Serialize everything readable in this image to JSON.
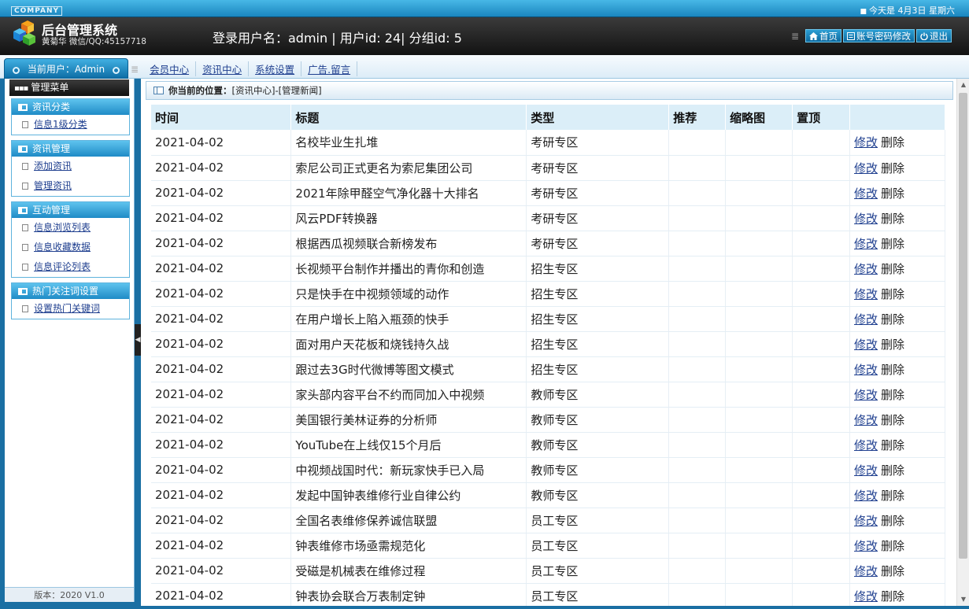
{
  "header": {
    "company": "COMPANY",
    "today": "今天是 4月3日  星期六",
    "title": "后台管理系统",
    "author": "黄菊华 微信/QQ:45157718",
    "login_info": "登录用户名：admin | 用户id: 24| 分组id: 5",
    "links": {
      "home": "首页",
      "password": "账号密码修改",
      "logout": "退出"
    },
    "colors": {
      "accent": "#1b86bf",
      "dark": "#1a1a1a"
    }
  },
  "subheader": {
    "current_user": "当前用户：Admin",
    "nav": [
      "会员中心",
      "资讯中心",
      "系统设置",
      "广告.留言"
    ]
  },
  "sidebar": {
    "menu_title": "管理菜单",
    "groups": [
      {
        "title": "资讯分类",
        "items": [
          "信息1级分类"
        ]
      },
      {
        "title": "资讯管理",
        "items": [
          "添加资讯",
          "管理资讯"
        ]
      },
      {
        "title": "互动管理",
        "items": [
          "信息浏览列表",
          "信息收藏数据",
          "信息评论列表"
        ]
      },
      {
        "title": "热门关注词设置",
        "items": [
          "设置热门关键词"
        ]
      }
    ],
    "version": "版本：2020 V1.0"
  },
  "main": {
    "crumb_label": "你当前的位置：",
    "crumb_path": "[资讯中心]-[管理新闻]",
    "columns": [
      "时间",
      "标题",
      "类型",
      "推荐",
      "缩略图",
      "置顶",
      ""
    ],
    "edit_label": "修改",
    "delete_label": "删除",
    "rows": [
      {
        "date": "2021-04-02",
        "title": "名校毕业生扎堆",
        "type": "考研专区"
      },
      {
        "date": "2021-04-02",
        "title": "索尼公司正式更名为索尼集团公司",
        "type": "考研专区"
      },
      {
        "date": "2021-04-02",
        "title": "2021年除甲醛空气净化器十大排名",
        "type": "考研专区"
      },
      {
        "date": "2021-04-02",
        "title": "风云PDF转换器",
        "type": "考研专区"
      },
      {
        "date": "2021-04-02",
        "title": "根据西瓜视频联合新榜发布",
        "type": "考研专区"
      },
      {
        "date": "2021-04-02",
        "title": "长视频平台制作并播出的青你和创造",
        "type": "招生专区"
      },
      {
        "date": "2021-04-02",
        "title": "只是快手在中视频领域的动作",
        "type": "招生专区"
      },
      {
        "date": "2021-04-02",
        "title": "在用户增长上陷入瓶颈的快手",
        "type": "招生专区"
      },
      {
        "date": "2021-04-02",
        "title": "面对用户天花板和烧钱持久战",
        "type": "招生专区"
      },
      {
        "date": "2021-04-02",
        "title": "跟过去3G时代微博等图文模式",
        "type": "招生专区"
      },
      {
        "date": "2021-04-02",
        "title": "家头部内容平台不约而同加入中视频",
        "type": "教师专区"
      },
      {
        "date": "2021-04-02",
        "title": "美国银行美林证券的分析师",
        "type": "教师专区"
      },
      {
        "date": "2021-04-02",
        "title": "YouTube在上线仅15个月后",
        "type": "教师专区"
      },
      {
        "date": "2021-04-02",
        "title": "中视频战国时代：新玩家快手已入局",
        "type": "教师专区"
      },
      {
        "date": "2021-04-02",
        "title": "发起中国钟表维修行业自律公约",
        "type": "教师专区"
      },
      {
        "date": "2021-04-02",
        "title": "全国名表维修保养诚信联盟",
        "type": "员工专区"
      },
      {
        "date": "2021-04-02",
        "title": "钟表维修市场亟需规范化",
        "type": "员工专区"
      },
      {
        "date": "2021-04-02",
        "title": "受磁是机械表在维修过程",
        "type": "员工专区"
      },
      {
        "date": "2021-04-02",
        "title": "钟表协会联合万表制定钟",
        "type": "员工专区"
      }
    ]
  }
}
